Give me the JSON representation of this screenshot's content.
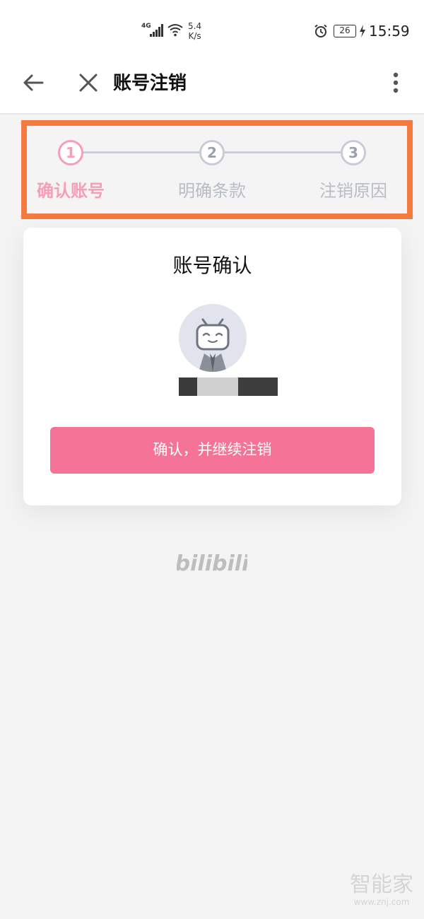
{
  "status_bar": {
    "network": "4G",
    "speed_value": "5.4",
    "speed_unit": "K/s",
    "battery": "26",
    "time": "15:59"
  },
  "nav": {
    "title": "账号注销"
  },
  "steps": [
    {
      "number": "1",
      "label": "确认账号",
      "active": true
    },
    {
      "number": "2",
      "label": "明确条款",
      "active": false
    },
    {
      "number": "3",
      "label": "注销原因",
      "active": false
    }
  ],
  "card": {
    "title": "账号确认",
    "confirm_label": "确认，并继续注销"
  },
  "brand": {
    "logo_text": "bilibili"
  },
  "watermark": {
    "name": "智能家",
    "url": "www.znj.com"
  },
  "colors": {
    "accent_pink": "#f57396",
    "step_active": "#f49fb6",
    "step_inactive": "#c9ccd6",
    "highlight_box": "#f47a3f"
  },
  "icons": {
    "back": "arrow-left-icon",
    "close": "close-icon",
    "more": "more-vertical-icon",
    "alarm": "alarm-icon",
    "wifi": "wifi-icon",
    "charging": "bolt-icon"
  }
}
